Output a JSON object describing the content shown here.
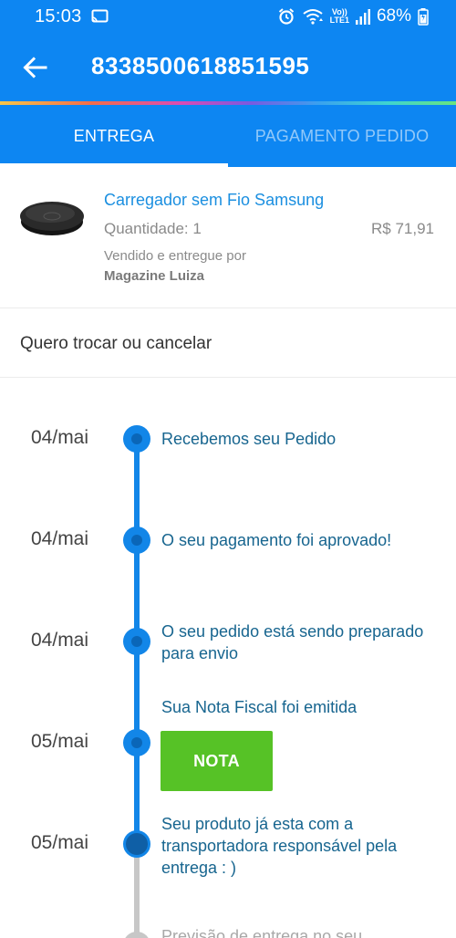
{
  "status_bar": {
    "time": "15:03",
    "battery_percent": "68%",
    "volte_label_1": "Vo))",
    "volte_label_2": "LTE1",
    "icons": [
      "cast-icon",
      "alarm-icon",
      "wifi-icon",
      "volte-icon",
      "signal-icon",
      "battery-icon"
    ]
  },
  "app_bar": {
    "title": "8338500618851595",
    "back_icon": "arrow-left-icon"
  },
  "tabs": [
    {
      "label": "ENTREGA",
      "active": true
    },
    {
      "label": "PAGAMENTO PEDIDO",
      "active": false
    }
  ],
  "product": {
    "name": "Carregador sem Fio Samsung",
    "quantity": "Quantidade: 1",
    "price": "R$ 71,91",
    "sold_label": "Vendido e entregue por",
    "seller": "Magazine Luiza"
  },
  "exchange": {
    "label": "Quero trocar ou cancelar"
  },
  "timeline": [
    {
      "date": "04/mai",
      "text": "Recebemos seu Pedido",
      "status": "done"
    },
    {
      "date": "04/mai",
      "text": "O seu pagamento foi aprovado!",
      "status": "done"
    },
    {
      "date": "04/mai",
      "text": "O seu pedido está sendo preparado para envio",
      "status": "done"
    },
    {
      "date": "05/mai",
      "text": "Sua Nota Fiscal foi emitida",
      "status": "done",
      "button_label": "NOTA"
    },
    {
      "date": "05/mai",
      "text": "Seu produto já esta com a transportadora responsável pela entrega : )",
      "status": "current"
    },
    {
      "date": "",
      "text": "Previsão de entrega no seu",
      "status": "pending"
    }
  ],
  "colors": {
    "primary": "#0d86f2",
    "timeline_blue": "#1286e8",
    "link_text": "#17658f",
    "nota_green": "#56c226",
    "pending_grey": "#c7c7c7"
  }
}
